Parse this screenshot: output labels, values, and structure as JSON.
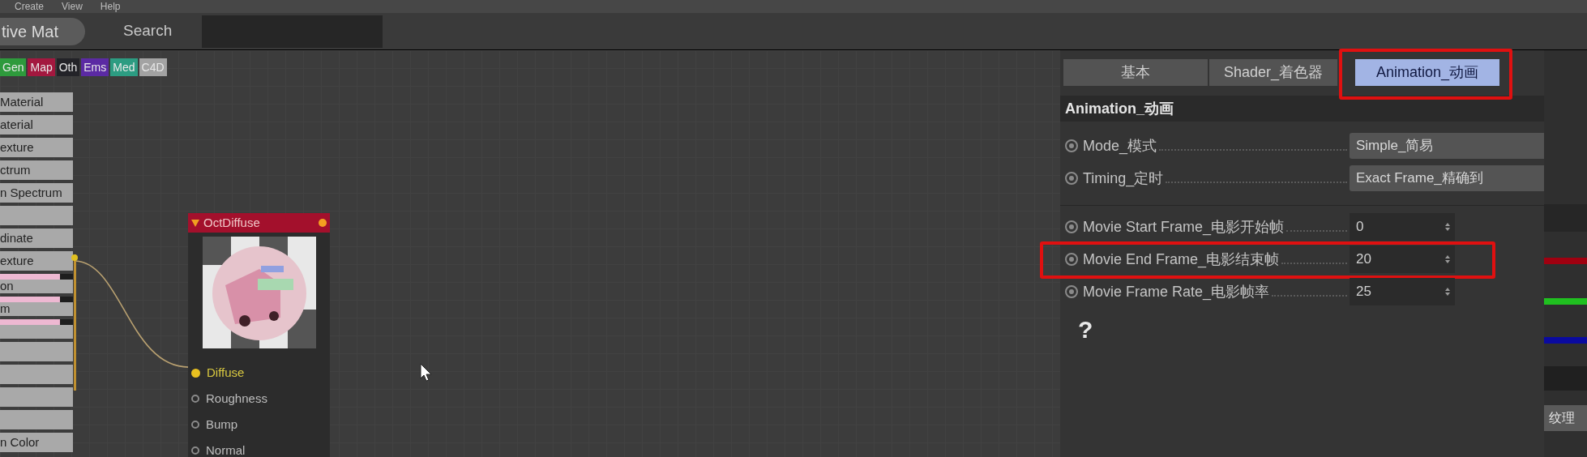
{
  "menu_bar": {
    "items": [
      "Create",
      "View",
      "Help"
    ]
  },
  "toolbar": {
    "mode_button": "tive Mat",
    "search_label": "Search"
  },
  "tags": [
    {
      "label": "Gen",
      "color": "#2e9a3c"
    },
    {
      "label": "Map",
      "color": "#a3183f"
    },
    {
      "label": "Oth",
      "color": "#232328"
    },
    {
      "label": "Ems",
      "color": "#5b2aa3"
    },
    {
      "label": "Med",
      "color": "#2c9c82"
    },
    {
      "label": "C4D",
      "color": "#a3a3a3"
    }
  ],
  "node_list": [
    {
      "label": "Material",
      "preview": false
    },
    {
      "label": "aterial",
      "preview": false
    },
    {
      "label": "exture",
      "preview": false
    },
    {
      "label": "ctrum",
      "preview": false
    },
    {
      "label": "n Spectrum",
      "preview": false
    },
    {
      "preview": false
    },
    {
      "label": "dinate",
      "preview": false
    },
    {
      "label": "exture",
      "preview": false
    },
    {
      "label": "on",
      "preview": true
    },
    {
      "label": "m",
      "preview": true
    },
    {
      "preview": true
    },
    {
      "preview": false
    },
    {
      "preview": false
    },
    {
      "preview": false
    },
    {
      "preview": false
    },
    {
      "label": "n Color",
      "preview": false
    }
  ],
  "node": {
    "title": "OctDiffuse",
    "ports": [
      {
        "label": "Diffuse",
        "connected": true
      },
      {
        "label": "Roughness",
        "connected": false
      },
      {
        "label": "Bump",
        "connected": false
      },
      {
        "label": "Normal",
        "connected": false
      }
    ]
  },
  "panel": {
    "tabs": [
      {
        "label": "基本",
        "selected": false,
        "highlighted": false
      },
      {
        "label": "Shader_着色器",
        "selected": false,
        "highlighted": false
      },
      {
        "label": "Animation_动画",
        "selected": true,
        "highlighted": true
      }
    ],
    "section_title": "Animation_动画",
    "fields": [
      {
        "kind": "dropdown",
        "label": "Mode_模式",
        "value": "Simple_简易",
        "highlighted": false
      },
      {
        "kind": "dropdown",
        "label": "Timing_定时",
        "value": "Exact Frame_精确到",
        "highlighted": false
      },
      {
        "kind": "divider"
      },
      {
        "kind": "number",
        "label": "Movie Start Frame_电影开始帧",
        "value": "0",
        "highlighted": false
      },
      {
        "kind": "number",
        "label": "Movie End Frame_电影结束帧",
        "value": "20",
        "highlighted": true
      },
      {
        "kind": "number",
        "label": "Movie Frame Rate_电影帧率",
        "value": "25",
        "highlighted": false
      }
    ],
    "help": "?"
  },
  "side_strip": {
    "button": "纹理"
  }
}
